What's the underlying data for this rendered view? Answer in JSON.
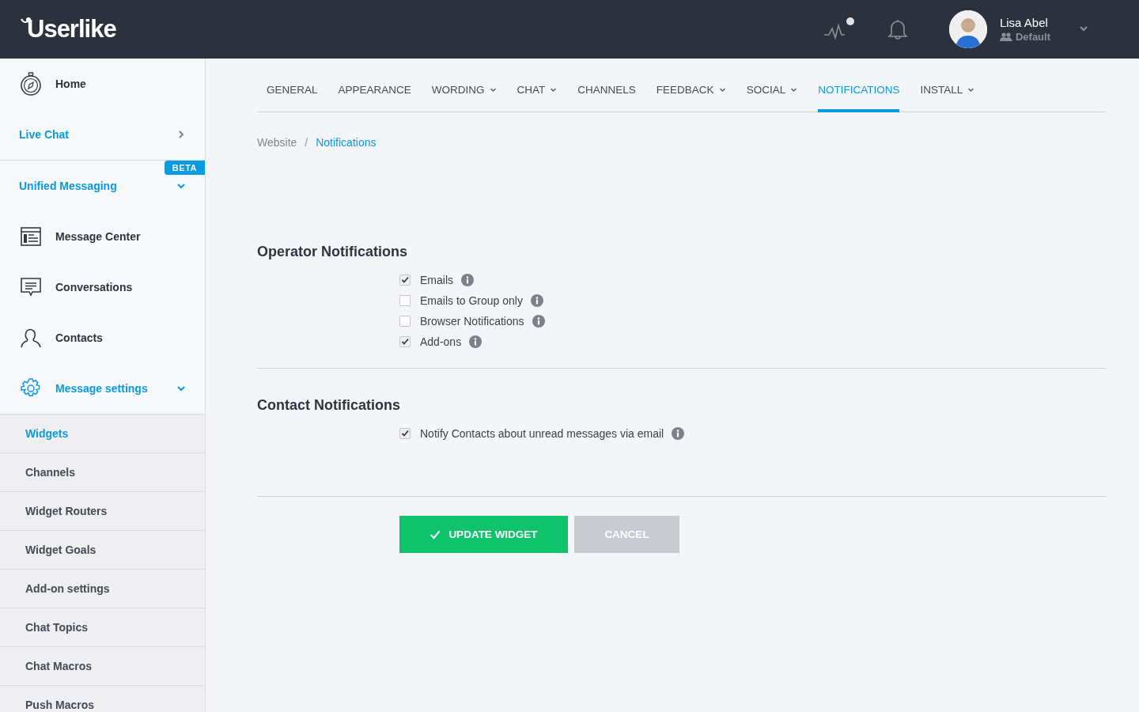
{
  "header": {
    "logo": "Userlike",
    "activity_alert": true,
    "user": {
      "name": "Lisa Abel",
      "role": "Default"
    }
  },
  "sidebar": {
    "items": [
      {
        "kind": "app",
        "label": "Home"
      },
      {
        "kind": "section",
        "label": "Live Chat",
        "expanded": false
      },
      {
        "kind": "section",
        "label": "Unified Messaging",
        "badge": "BETA",
        "expanded": true,
        "children": [
          {
            "kind": "app",
            "label": "Message Center"
          },
          {
            "kind": "app",
            "label": "Conversations"
          },
          {
            "kind": "app",
            "label": "Contacts"
          },
          {
            "kind": "app-section",
            "label": "Message settings",
            "expanded": true,
            "children": [
              {
                "kind": "sub",
                "label": "Widgets",
                "selected": true
              },
              {
                "kind": "sub",
                "label": "Channels",
                "selected": false
              },
              {
                "kind": "sub",
                "label": "Widget Routers",
                "selected": false
              },
              {
                "kind": "sub",
                "label": "Widget Goals",
                "selected": false
              },
              {
                "kind": "sub",
                "label": "Add-on settings",
                "selected": false
              },
              {
                "kind": "sub",
                "label": "Chat Topics",
                "selected": false
              },
              {
                "kind": "sub",
                "label": "Chat Macros",
                "selected": false
              },
              {
                "kind": "sub",
                "label": "Push Macros",
                "selected": false
              }
            ]
          }
        ]
      }
    ]
  },
  "tabs": [
    {
      "label": "GENERAL",
      "selected": false,
      "dropdown": false
    },
    {
      "label": "APPEARANCE",
      "selected": false,
      "dropdown": false
    },
    {
      "label": "WORDING",
      "selected": false,
      "dropdown": true
    },
    {
      "label": "CHAT",
      "selected": false,
      "dropdown": true
    },
    {
      "label": "CHANNELS",
      "selected": false,
      "dropdown": false
    },
    {
      "label": "FEEDBACK",
      "selected": false,
      "dropdown": true
    },
    {
      "label": "SOCIAL",
      "selected": false,
      "dropdown": true
    },
    {
      "label": "NOTIFICATIONS",
      "selected": true,
      "dropdown": false
    },
    {
      "label": "INSTALL",
      "selected": false,
      "dropdown": true
    }
  ],
  "breadcrumb": {
    "separator": "/",
    "items": [
      {
        "label": "Website",
        "selected": false
      },
      {
        "label": "Notifications",
        "selected": true
      }
    ]
  },
  "sections": [
    {
      "title": "Operator Notifications",
      "options": [
        {
          "label": "Emails",
          "checked": true
        },
        {
          "label": "Emails to Group only",
          "checked": false
        },
        {
          "label": "Browser Notifications",
          "checked": false
        },
        {
          "label": "Add-ons",
          "checked": true
        }
      ]
    },
    {
      "title": "Contact Notifications",
      "options": [
        {
          "label": "Notify Contacts about unread messages via email",
          "checked": true
        }
      ]
    }
  ],
  "buttons": [
    {
      "kind": "primary",
      "label": "UPDATE WIDGET"
    },
    {
      "kind": "secondary",
      "label": "CANCEL"
    }
  ]
}
